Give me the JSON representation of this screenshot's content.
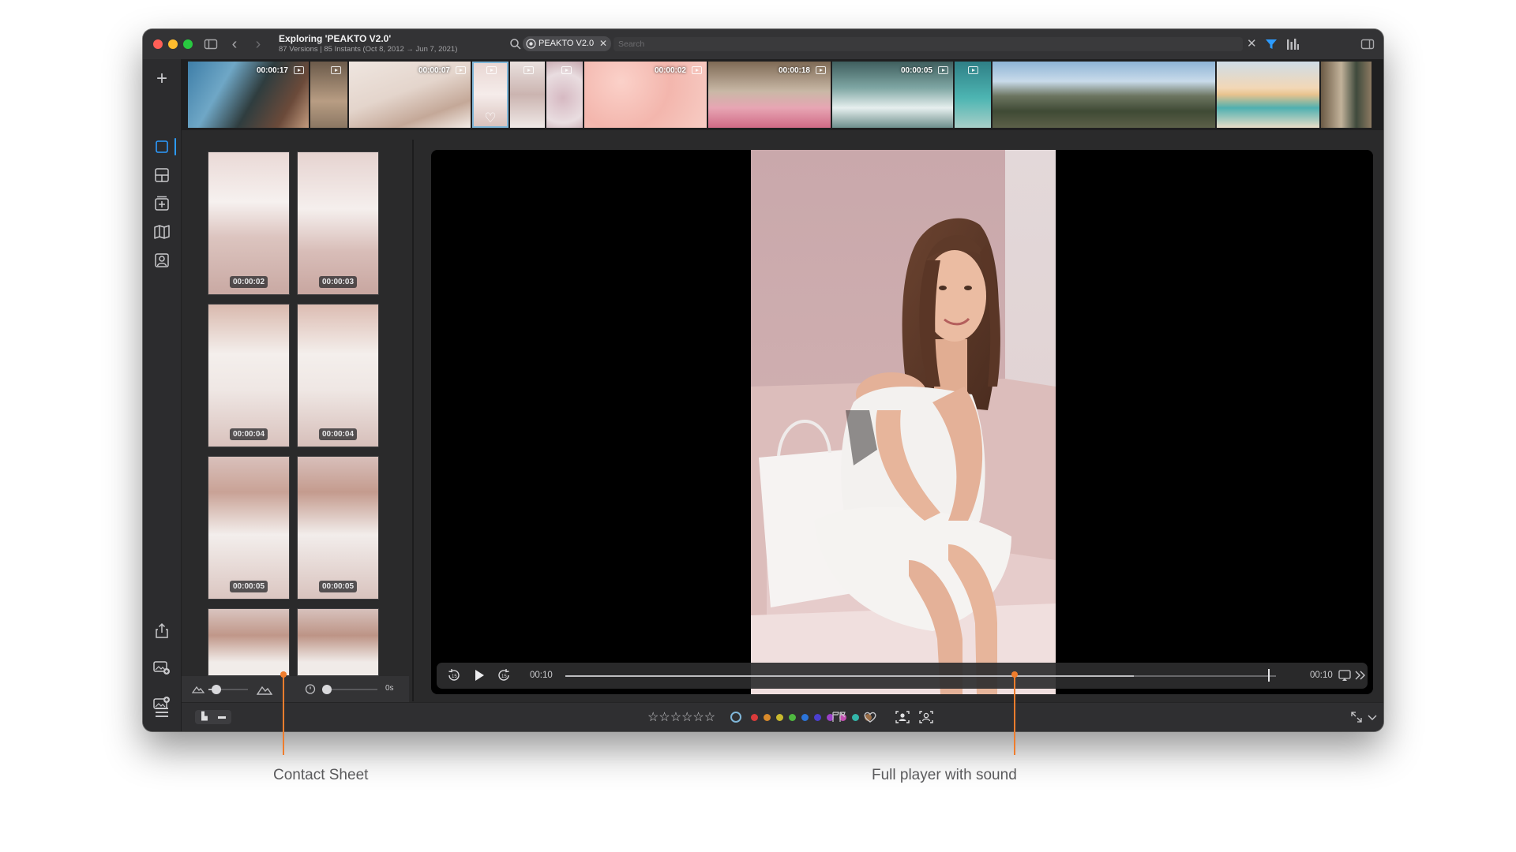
{
  "window": {
    "title": "Exploring 'PEAKTO V2.0'",
    "subtitle": "87 Versions | 85 Instants (Oct 8, 2012 → Jun 7, 2021)"
  },
  "search": {
    "chip_label": "PEAKTO V2.0",
    "placeholder": "Search",
    "clear_glyph": "✕",
    "chip_close_glyph": "✕"
  },
  "filmstrip": {
    "durations": [
      "00:00:17",
      "00:00:07",
      "00:00:02",
      "00:00:18",
      "00:00:05"
    ],
    "heart_glyph": "♡"
  },
  "contact_sheet": {
    "durations": [
      "00:00:02",
      "00:00:03",
      "00:00:04",
      "00:00:04",
      "00:00:05",
      "00:00:05"
    ],
    "delay_label": "0s",
    "zoom_level": 0.2,
    "delay_level": 0.0
  },
  "player": {
    "current_time": "00:10",
    "end_time": "00:10",
    "progress": 0.8
  },
  "bottom_bar": {
    "stars": "☆☆☆☆☆☆",
    "doc_glyph": "▙",
    "folder_glyph": "▬",
    "color_labels": [
      "#2b9de8",
      "#d93b3b",
      "#d98a2b",
      "#c9b92e",
      "#4fb840",
      "#2b74d9",
      "#4b3fd0",
      "#9b40c8",
      "#c44fb2",
      "#33b5a9",
      "#9a6e47"
    ]
  },
  "annotations": {
    "contact_sheet": "Contact Sheet",
    "full_player": "Full player with sound"
  },
  "colors": {
    "accent": "#2c9bff",
    "callout": "#ef7d2d",
    "window_bg": "#2a2a2b"
  },
  "icons": [
    "sidebar-toggle-icon",
    "back-icon",
    "forward-icon",
    "search-icon",
    "filter-icon",
    "stats-icon",
    "panel-toggle-icon",
    "plus-icon",
    "single-view-icon",
    "grid-view-icon",
    "add-album-icon",
    "map-icon",
    "people-icon",
    "share-icon",
    "import-icon",
    "new-collection-icon",
    "menu-icon",
    "replay-icon",
    "play-icon",
    "skip-icon",
    "airplay-icon",
    "expand-icon",
    "flag-icon",
    "heart-icon",
    "face-detect-icon",
    "face-icon",
    "fullscreen-icon",
    "chevron-down-icon"
  ]
}
